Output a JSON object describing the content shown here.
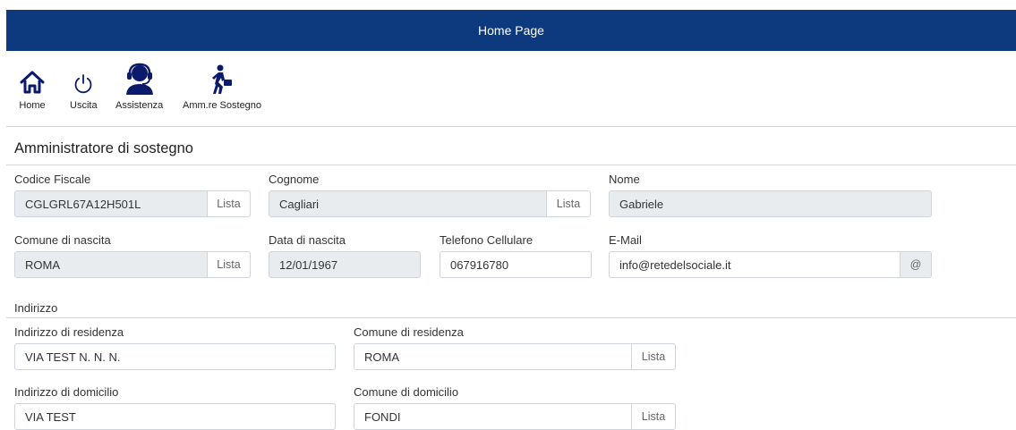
{
  "header": {
    "title": "Home Page"
  },
  "toolbar": {
    "home": "Home",
    "exit": "Uscita",
    "support": "Assistenza",
    "admin": "Amm.re Sostegno"
  },
  "section": {
    "title": "Amministratore di sostegno",
    "address_title": "Indirizzo"
  },
  "form": {
    "codice_fiscale": {
      "label": "Codice Fiscale",
      "value": "CGLGRL67A12H501L",
      "button": "Lista"
    },
    "cognome": {
      "label": "Cognome",
      "value": "Cagliari",
      "button": "Lista"
    },
    "nome": {
      "label": "Nome",
      "value": "Gabriele"
    },
    "comune_nascita": {
      "label": "Comune di nascita",
      "value": "ROMA",
      "button": "Lista"
    },
    "data_nascita": {
      "label": "Data di nascita",
      "value": "12/01/1967"
    },
    "telefono": {
      "label": "Telefono Cellulare",
      "value": "067916780"
    },
    "email": {
      "label": "E-Mail",
      "value": "info@retedelsociale.it",
      "addon": "@"
    },
    "indirizzo_residenza": {
      "label": "Indirizzo di residenza",
      "value": "VIA TEST N.  N.  N."
    },
    "comune_residenza": {
      "label": "Comune di residenza",
      "value": "ROMA",
      "button": "Lista"
    },
    "indirizzo_domicilio": {
      "label": "Indirizzo di domicilio",
      "value": "VIA TEST"
    },
    "comune_domicilio": {
      "label": "Comune di domicilio",
      "value": "FONDI",
      "button": "Lista"
    }
  },
  "colors": {
    "header_bg": "#0d3a7e",
    "icon_navy": "#0b1a6b"
  }
}
